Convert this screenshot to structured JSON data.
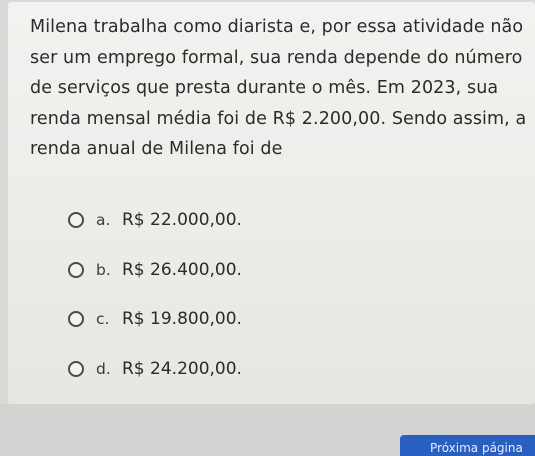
{
  "question": {
    "text": "Milena trabalha como diarista e, por essa atividade não ser um emprego formal, sua renda depende do número de serviços que presta durante o mês. Em 2023, sua renda mensal média foi de R$ 2.200,00. Sendo assim, a renda anual de Milena foi de"
  },
  "options": [
    {
      "letter": "a.",
      "text": "R$ 22.000,00."
    },
    {
      "letter": "b.",
      "text": "R$ 26.400,00."
    },
    {
      "letter": "c.",
      "text": "R$ 19.800,00."
    },
    {
      "letter": "d.",
      "text": "R$ 24.200,00."
    }
  ],
  "footer": {
    "next_label": "Próxima página"
  },
  "colors": {
    "accent": "#2a5fc2"
  }
}
